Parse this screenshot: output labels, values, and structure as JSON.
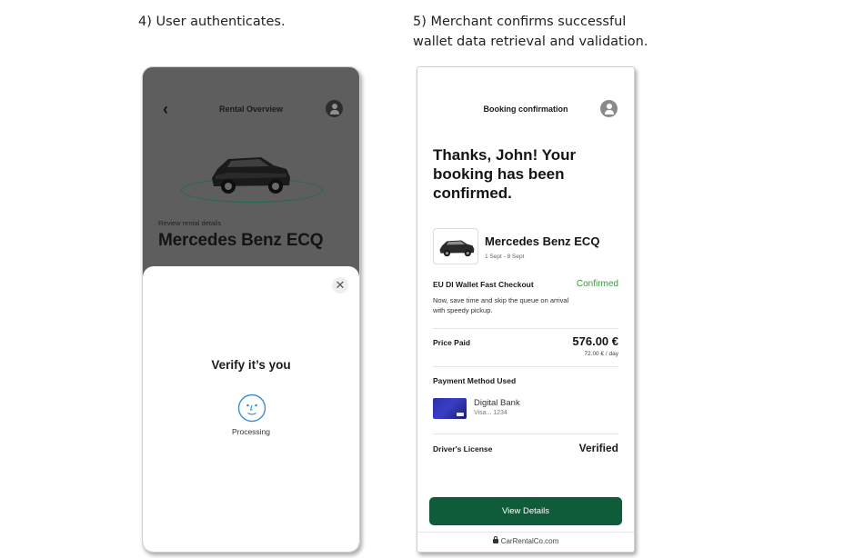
{
  "captions": {
    "left": "4) User authenticates.",
    "right_line1": "5) Merchant confirms successful",
    "right_line2": "wallet data retrieval and validation."
  },
  "screen1": {
    "back_icon": "chevron-left-icon",
    "title": "Rental Overview",
    "review_label": "Review rental details",
    "car_name": "Mercedes Benz ECQ",
    "close_icon": "close-icon",
    "verify_title": "Verify it’s you",
    "face_icon": "face-scan-icon",
    "status": "Processing"
  },
  "screen2": {
    "title": "Booking confirmation",
    "thanks_line1": "Thanks, John! Your",
    "thanks_line2": "booking has been",
    "thanks_line3": "confirmed.",
    "car_name": "Mercedes Benz ECQ",
    "dates": "1 Sept - 8 Sept",
    "checkout_label": "EU DI Wallet Fast Checkout",
    "checkout_status": "Confirmed",
    "checkout_desc_line1": "Now, save time and skip the queue on arrival",
    "checkout_desc_line2": "with speedy pickup.",
    "price_label": "Price Paid",
    "price_value": "576.00 €",
    "price_per_day": "72.00 € / day",
    "payment_label": "Payment Method Used",
    "bank_name": "Digital Bank",
    "card_number": "Visa... 1234",
    "license_label": "Driver's License",
    "license_status": "Verified",
    "button_label": "View Details",
    "site": "CarRentalCo.com"
  },
  "colors": {
    "accent_green": "#0f5c3b",
    "confirmed_green": "#2f9e3b",
    "overlay_gray": "#5e5e5e",
    "card_blue": "#2d2fa8"
  }
}
